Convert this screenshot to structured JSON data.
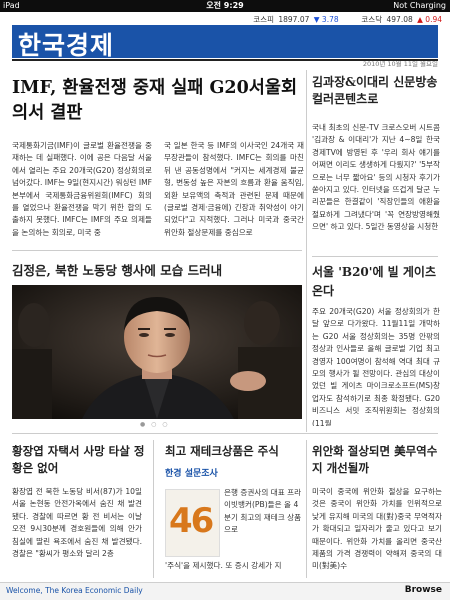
{
  "status_bar": {
    "device": "iPad",
    "time": "오전 9:29",
    "battery": "Not Charging"
  },
  "ticker": {
    "kospi_label": "코스피",
    "kospi_value": "1897.07",
    "kospi_change": "▼ 3.78",
    "kosdaq_label": "코스닥",
    "kosdaq_value": "497.08",
    "kosdaq_change": "▲ 0.94",
    "down_color": "#1a4fd6",
    "up_color": "#d01818"
  },
  "masthead": {
    "name": "한국경제",
    "date": "2010년 10월 11일 월요일",
    "brand_color": "#1a53a8"
  },
  "lead": {
    "title": "IMF, 환율전쟁 중재 실패 G20서울회의서 결판",
    "col1": "국제통화기금(IMF)이 글로벌 환율전쟁을 중재하는 데 실패했다. 이에 공은 다음달 서울에서 열리는 주요 20개국(G20) 정상회의로 넘어갔다. IMF는 9일(현지시간) 워싱턴 IMF본부에서 국제통화금융위원회(IMFC) 회의를 열었으나 환율전쟁을 막기 위한 합의 도출하지 못했다. IMFC는 IMF의 주요 의제들을 논의하는 회의로, 미국 중",
    "col2": "국 일본 한국 등 IMF의 이사국인 24개국 재무장관들이 참석했다. IMFC는 회의를 마친뒤 낸 공동성명에서 \"커지는 세계경제 불균형, 변동성 높은 자본의 흐름과 환율 움직임, 외환 보유액의 축적과 관련된 문제 때문에 (글로벌 경제·금융에) 긴장과 취약성이 야기되었다\"고 지적했다. 그러나 미국과 중국간 위안화 절상문제를 중심으로"
  },
  "side1": {
    "title": "김과장&이대리 신문방송 컬러콘텐츠로",
    "body": "국내 최초의 신문-TV 크로스오버 시트콤 '김과장 & 이대리'가 지난 4~8일 한국경제TV에 방영된 후 '우리 회사 얘기를 어쩌면 이리도 생생하게 다뤘지?' '5부작으로는 너무 짧아요' 등의 시청자 후기가 쏟아지고 있다. 인터넷을 뜨겁게 달군 누리꾼들은 한결같이 '직장인들의 애환을 절묘하게 그려냈다'며 '꼭 연장방영해줬으면' 하고 있다. 5일간 동영상을 시청한"
  },
  "photo_story": {
    "title": "김정은, 북한 노동당 행사에 모습 드러내"
  },
  "side2": {
    "title": "서울 'B20'에 빌 게이츠 온다",
    "body": "주요 20개국(G20) 서울 정상회의가 한달 앞으로 다가왔다. 11월11일 개막하는 G20 서울 정상회의는 35명 안팎의 정상과 인사들로 올해 글로벌 기업 최고경영자 100여명이 참석해 역대 최대 규모의 행사가 될 전망이다. 관심의 대상이었던 빌 게이츠 마이크로소프트(MS)창업자도 참석하기로 최종 확정됐다. G20 비즈니스 서밋 조직위원회는 정상회의(11월"
  },
  "bottom1": {
    "title": "황장엽 자택서 사망 타살 정황은 없어",
    "body": "황장엽 전 북한 노동당 비서(87)가 10일 서울 논현동 안전가옥에서 숨진 채 발견됐다. 경찰에 따르면 황 전 비서는 이날 오전 9시30분께 경호원들에 의해 안가 침실에 딸린 욕조에서 숨진 채 발견됐다. 경찰은 \"황씨가 평소와 달리 2층"
  },
  "bottom2": {
    "title": "최고 재테크상품은 주식",
    "poll_label": "한경 설문조사",
    "poll_number": "46",
    "body": "은행 증권사의 대표 프라이빗뱅커(PB)들은 올 4분기 최고의 재테크 상품으로",
    "body2": "'주식'을 제시했다. 또 증시 강세가 지"
  },
  "bottom3": {
    "title": "위안화 절상되면 美무역수지 개선될까",
    "body": "미국이 중국에 위안화 절상을 요구하는 것은 중국이 위안화 가치를 인위적으로 낮게 유지해 미국의 대(對)중국 무역적자가 확대되고 일자리가 줄고 있다고 보기 때문이다. 위안화 가치를 올리면 중국산 제품의 가격 경쟁력이 약해져 중국의 대미(對美)수"
  },
  "footer": {
    "welcome": "Welcome, The Korea Economic Daily",
    "browse": "Browse"
  }
}
